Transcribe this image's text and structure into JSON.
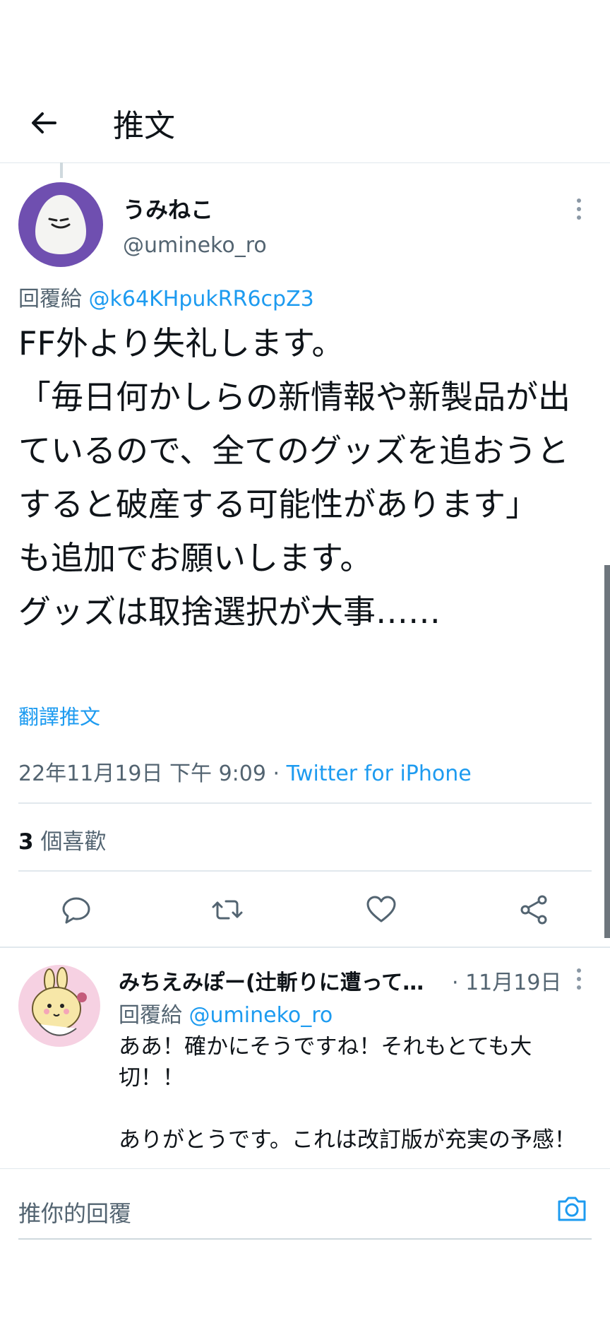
{
  "header": {
    "title": "推文"
  },
  "tweet": {
    "author_name": "うみねこ",
    "author_handle": "@umineko_ro",
    "reply_label": "回覆給",
    "reply_to": "@k64KHpukRR6cpZ3",
    "text": "FF外より失礼します。\n「毎日何かしらの新情報や新製品が出ているので、全てのグッズを追おうとすると破産する可能性があります」\nも追加でお願いします。\nグッズは取捨選択が大事……",
    "translate_label": "翻譯推文",
    "timestamp": "22年11月19日 下午 9:09",
    "separator": " · ",
    "source": "Twitter for iPhone",
    "likes_count": "3",
    "likes_label": "個喜歡"
  },
  "reply": {
    "author_name": "みちえみぽー(辻斬りに遭って…",
    "date": " · 11月19日",
    "reply_label": "回覆給",
    "reply_to": "@umineko_ro",
    "text": "ああ！確かにそうですね！それもとても大切！！\n\nありがとうです。これは改訂版が充実の予感！"
  },
  "compose": {
    "placeholder": "推你的回覆"
  },
  "colors": {
    "link": "#1d9bf0",
    "avatar_main_bg": "#6f4fb0",
    "avatar_reply_bg": "#f6d1e2"
  },
  "icons": [
    "back-arrow-icon",
    "more-vertical-icon",
    "reply-icon",
    "retweet-icon",
    "like-icon",
    "share-icon",
    "camera-icon"
  ]
}
